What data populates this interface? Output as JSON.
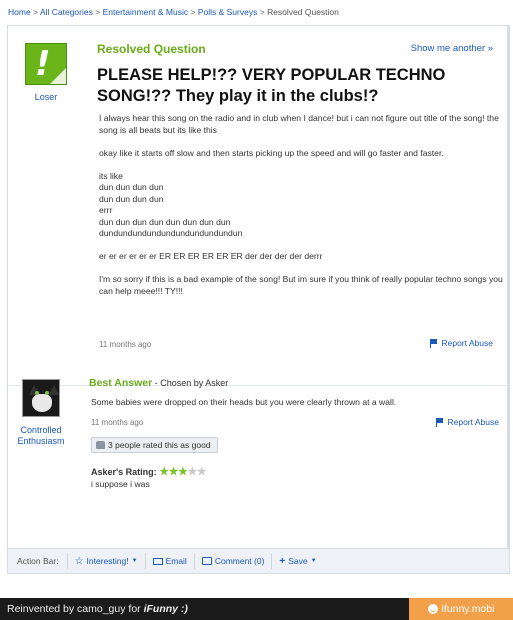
{
  "breadcrumb": {
    "items": [
      "Home",
      "All Categories",
      "Entertainment & Music",
      "Polls & Surveys"
    ],
    "current": "Resolved Question",
    "separator": ">"
  },
  "question": {
    "status_label": "Resolved Question",
    "show_another": "Show me another »",
    "asker_name": "Loser",
    "title": "PLEASE HELP!?? VERY POPULAR TECHNO SONG!?? They play it in the clubs!?",
    "body_paragraphs": [
      "I always hear this song on the radio and in club when I dance! but i can not figure out title of the song! the song is all beats but its like this",
      "okay like it starts off slow and then starts picking up the speed and will go faster and faster.",
      "its like\ndun dun dun dun\ndun dun dun dun\nerrr\ndun dun dun dun dun dun dun dun\ndundundundundundundundundundun",
      "er er er er er er ER ER ER ER ER ER der der der der derrr",
      "I'm so sorry if this is a bad example of the song! But im sure if you think of really popular techno songs you can help meee!!! TY!!!"
    ],
    "time": "11 months ago",
    "report_label": "Report Abuse"
  },
  "answer": {
    "best_answer_label": "Best Answer",
    "chosen_by": " - Chosen by Asker",
    "answerer_name": "Controlled Enthusiasm",
    "text": "Some babies were dropped on their heads but you were clearly thrown at a wall.",
    "time": "11 months ago",
    "report_label": "Report Abuse",
    "rated_label": "3 people rated this as good",
    "asker_rating_label": "Asker's Rating:",
    "asker_rating_stars": 3,
    "asker_rating_max": 5,
    "asker_comment": "i suppose i was"
  },
  "action_bar": {
    "label": "Action Bar:",
    "interesting": "Interesting!",
    "email": "Email",
    "comment": "Comment (0)",
    "save": "Save"
  },
  "footer": {
    "credit": "Reinvented by camo_guy for ",
    "credit_brand": "iFunny :)",
    "site": "ifunny.mobi"
  },
  "colors": {
    "link_blue": "#1d5ab8",
    "resolved_green": "#6aab19",
    "brand_orange": "#f3a04b"
  }
}
